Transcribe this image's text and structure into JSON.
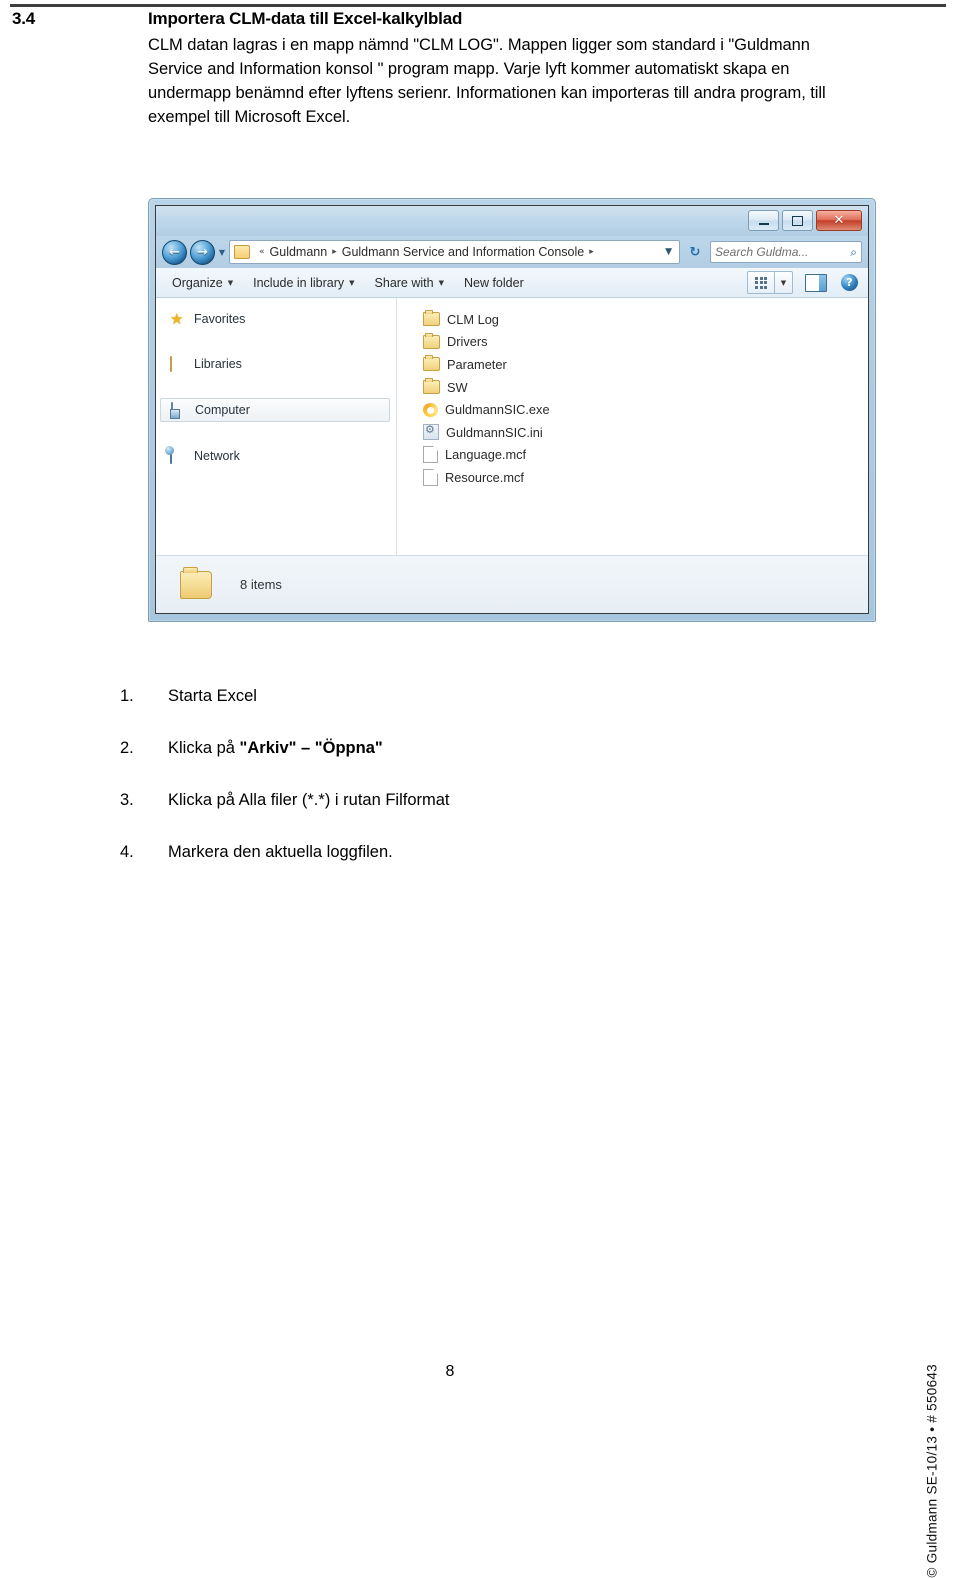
{
  "document": {
    "section_number": "3.4",
    "section_title": "Importera CLM-data till Excel-kalkylblad",
    "body_paragraph": "CLM datan lagras i en mapp nämnd \"CLM LOG\". Mappen ligger som standard i \"Guldmann Service and Information konsol \" program mapp. Varje lyft kommer automatiskt skapa en undermapp benämnd efter lyftens serienr. Informationen kan importeras till andra program, till exempel till Microsoft Excel.",
    "page_number": "8",
    "side_credit": "© Guldmann SE-10/13 • # 550643"
  },
  "explorer": {
    "window_controls": {
      "minimize": "minimize-icon",
      "maximize": "maximize-icon",
      "close": "✕"
    },
    "navigation": {
      "back_arrow": "←",
      "forward_arrow": "→",
      "recent_caret": "▼",
      "breadcrumb_root": "Guldmann",
      "breadcrumb_chevron": "«",
      "breadcrumb_sep": "▸",
      "breadcrumb_current": "Guldmann Service and Information Console",
      "breadcrumb_end_sep": "▸",
      "dropdown_caret": "▼",
      "refresh_icon": "↻",
      "search_placeholder": "Search Guldma...",
      "search_icon": "⌕"
    },
    "toolbar": {
      "items": [
        {
          "label": "Organize",
          "caret": "▼"
        },
        {
          "label": "Include in library",
          "caret": "▼"
        },
        {
          "label": "Share with",
          "caret": "▼"
        },
        {
          "label": "New folder",
          "caret": ""
        }
      ],
      "view_caret": "▼",
      "help_label": "?"
    },
    "nav_pane": [
      {
        "label": "Favorites",
        "icon": "star-icon",
        "selected": false
      },
      {
        "label": "Libraries",
        "icon": "libraries-icon",
        "selected": false
      },
      {
        "label": "Computer",
        "icon": "computer-icon",
        "selected": true
      },
      {
        "label": "Network",
        "icon": "network-icon",
        "selected": false
      }
    ],
    "files": [
      {
        "name": "CLM Log",
        "type": "folder"
      },
      {
        "name": "Drivers",
        "type": "folder"
      },
      {
        "name": "Parameter",
        "type": "folder"
      },
      {
        "name": "SW",
        "type": "folder"
      },
      {
        "name": "GuldmannSIC.exe",
        "type": "exe"
      },
      {
        "name": "GuldmannSIC.ini",
        "type": "ini"
      },
      {
        "name": "Language.mcf",
        "type": "doc"
      },
      {
        "name": "Resource.mcf",
        "type": "doc"
      }
    ],
    "status": {
      "text": "8 items",
      "icon": "folder-icon"
    }
  },
  "steps": [
    {
      "num": "1.",
      "text_plain": "Starta Excel",
      "bold_parts": []
    },
    {
      "num": "2.",
      "text_plain": "",
      "prefix": "Klicka på ",
      "bold": "\"Arkiv\" – \"Öppna\"",
      "suffix": ""
    },
    {
      "num": "3.",
      "text_plain": "Klicka på Alla filer (*.*) i rutan Filformat",
      "bold_parts": []
    },
    {
      "num": "4.",
      "text_plain": "Markera den aktuella loggfilen.",
      "bold_parts": []
    }
  ]
}
